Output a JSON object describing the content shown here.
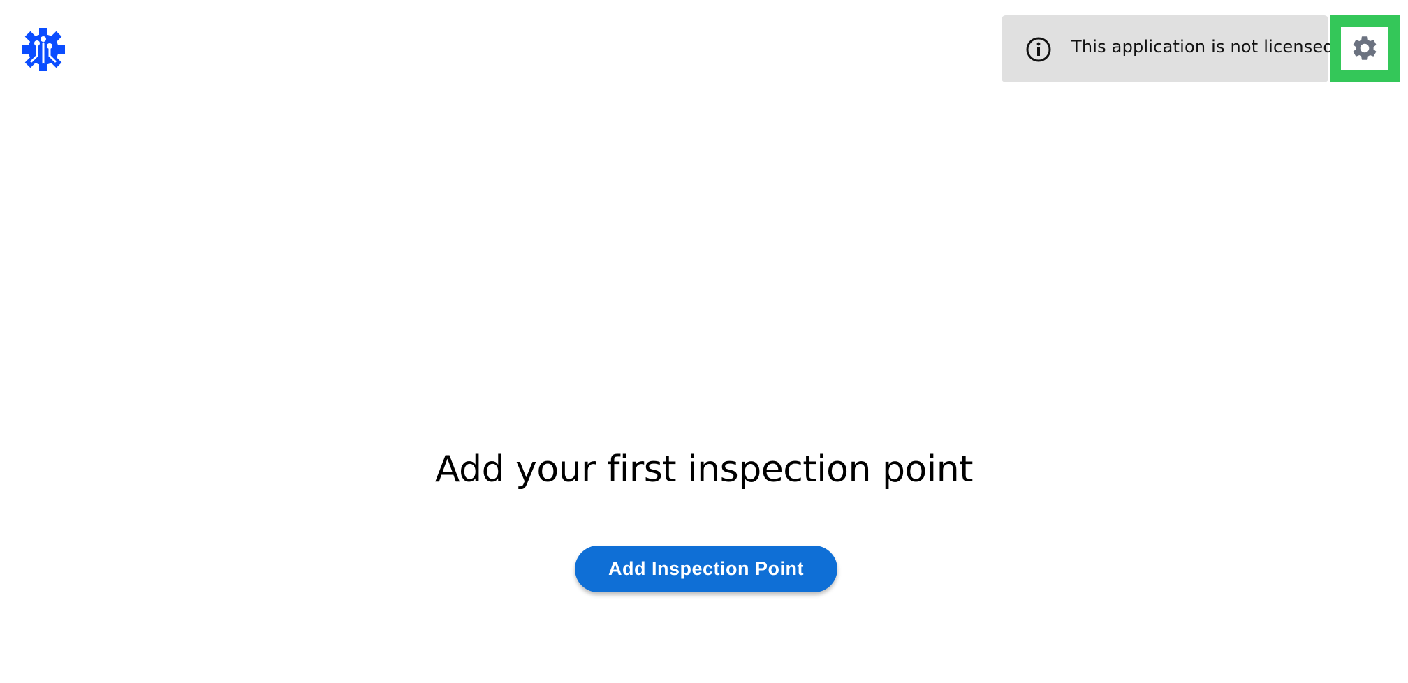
{
  "header": {
    "logo_icon": "gear-circuit-logo-icon",
    "logo_color": "#0b4dff",
    "license_banner": {
      "icon": "info-icon",
      "text": "This application is not licensed",
      "background": "#e0e0e0"
    },
    "settings": {
      "icon": "gear-icon",
      "highlight_color": "#34c759",
      "icon_color": "#6b7280"
    }
  },
  "main": {
    "empty_state_title": "Add your first inspection point",
    "add_button_label": "Add Inspection Point",
    "add_button_color": "#0f6fd6"
  }
}
